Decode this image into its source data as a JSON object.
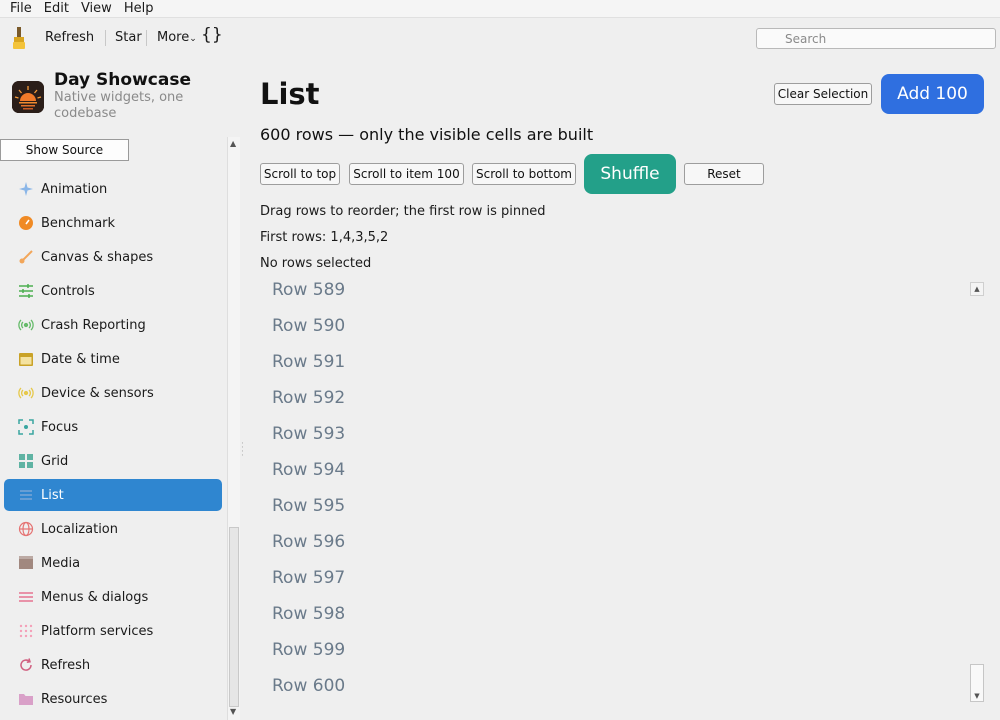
{
  "menubar": {
    "items": [
      "File",
      "Edit",
      "View",
      "Help"
    ]
  },
  "toolbar": {
    "refresh": "Refresh",
    "star": "Star",
    "more": "More",
    "more_caret": "⌄",
    "braces": "{}",
    "search_placeholder": "Search"
  },
  "sidebar": {
    "app_title": "Day Showcase",
    "app_subtitle": "Native widgets, one codebase",
    "show_source": "Show Source",
    "items": [
      {
        "label": "Animation",
        "icon": "sparkle-icon",
        "color": "#8ab6e8"
      },
      {
        "label": "Benchmark",
        "icon": "gauge-icon",
        "color": "#f08a24"
      },
      {
        "label": "Canvas & shapes",
        "icon": "brush-icon",
        "color": "#f2a65a"
      },
      {
        "label": "Controls",
        "icon": "sliders-icon",
        "color": "#4caf50"
      },
      {
        "label": "Crash Reporting",
        "icon": "broadcast-icon",
        "color": "#66bb6a"
      },
      {
        "label": "Date & time",
        "icon": "calendar-icon",
        "color": "#c9a227"
      },
      {
        "label": "Device & sensors",
        "icon": "sensor-icon",
        "color": "#e6c84a"
      },
      {
        "label": "Focus",
        "icon": "focus-icon",
        "color": "#3aa6a0"
      },
      {
        "label": "Grid",
        "icon": "grid-icon",
        "color": "#5fb3a3"
      },
      {
        "label": "List",
        "icon": "list-icon",
        "color": "#7aa6d6"
      },
      {
        "label": "Localization",
        "icon": "globe-icon",
        "color": "#e57373"
      },
      {
        "label": "Media",
        "icon": "film-icon",
        "color": "#a1887f"
      },
      {
        "label": "Menus & dialogs",
        "icon": "menu-icon",
        "color": "#e57390"
      },
      {
        "label": "Platform services",
        "icon": "dots-grid-icon",
        "color": "#f4a0b8"
      },
      {
        "label": "Refresh",
        "icon": "refresh-icon",
        "color": "#d06080"
      },
      {
        "label": "Resources",
        "icon": "folder-icon",
        "color": "#d9a0c8"
      }
    ],
    "selected": "List"
  },
  "main": {
    "title": "List",
    "clear_selection": "Clear Selection",
    "add_100": "Add 100",
    "subtitle": "600 rows — only the visible cells are built",
    "scroll_top": "Scroll to top",
    "scroll_item_100": "Scroll to item 100",
    "scroll_bottom": "Scroll to bottom",
    "shuffle": "Shuffle",
    "reset": "Reset",
    "hint": "Drag rows to reorder; the first row is pinned",
    "first_rows": "First rows: 1,4,3,5,2",
    "selection_status": "No rows selected",
    "rows": [
      "Row 589",
      "Row 590",
      "Row 591",
      "Row 592",
      "Row 593",
      "Row 594",
      "Row 595",
      "Row 596",
      "Row 597",
      "Row 598",
      "Row 599",
      "Row 600"
    ]
  },
  "colors": {
    "accent": "#2f86d0",
    "primary_button": "#2f6fe0",
    "shuffle_button": "#23a089",
    "row_text": "#6a7a8a"
  }
}
